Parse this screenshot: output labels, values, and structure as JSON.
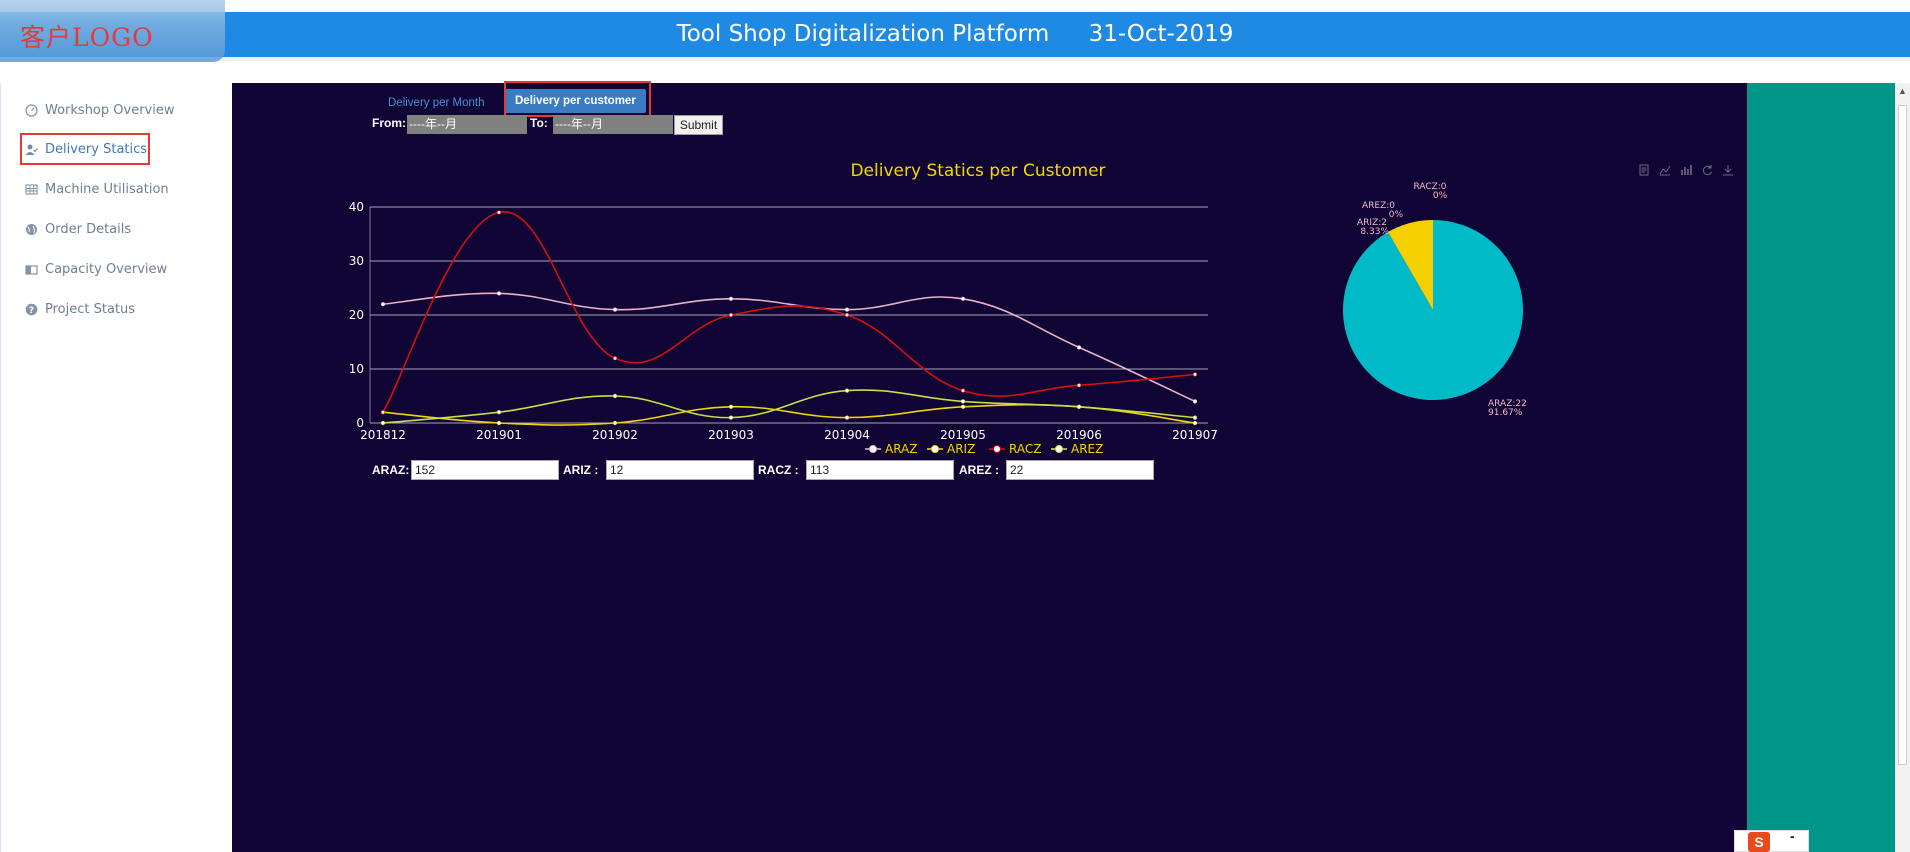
{
  "header": {
    "logo_text": "客户LOGO",
    "title": "Tool Shop Digitalization Platform",
    "date": "31-Oct-2019"
  },
  "sidebar": {
    "items": [
      {
        "label": "Workshop Overview",
        "icon": "dashboard-icon"
      },
      {
        "label": "Delivery Statics",
        "icon": "user-check-icon",
        "active": true
      },
      {
        "label": "Machine Utilisation",
        "icon": "table-icon"
      },
      {
        "label": "Order Details",
        "icon": "globe-icon"
      },
      {
        "label": "Capacity Overview",
        "icon": "folder-icon"
      },
      {
        "label": "Project Status",
        "icon": "help-circle-icon"
      }
    ]
  },
  "tabs": {
    "month": "Delivery per Month",
    "customer": "Delivery per customer"
  },
  "filter": {
    "from_label": "From:",
    "from_value": "----年--月",
    "to_label": "To:",
    "to_value": "----年--月",
    "submit_label": "Submit"
  },
  "totals": [
    {
      "label": "ARAZ:",
      "value": "152"
    },
    {
      "label": "ARIZ :",
      "value": "12"
    },
    {
      "label": "RACZ :",
      "value": "113"
    },
    {
      "label": "AREZ :",
      "value": "22"
    }
  ],
  "colors": {
    "header": "#1f8ae3",
    "panel": "#100535",
    "teal": "#009688",
    "highlight": "#e53935",
    "title": "#f5d700"
  },
  "chart_data": [
    {
      "type": "line",
      "title": "Delivery Statics per Customer",
      "categories": [
        "201812",
        "201901",
        "201902",
        "201903",
        "201904",
        "201905",
        "201906",
        "201907"
      ],
      "ylim": [
        0,
        40
      ],
      "yticks": [
        0,
        10,
        20,
        30,
        40
      ],
      "grid": true,
      "legend": "bottom",
      "series": [
        {
          "name": "ARAZ",
          "color": "#e8b4c8",
          "values": [
            22,
            24,
            21,
            23,
            21,
            23,
            14,
            4
          ]
        },
        {
          "name": "ARIZ",
          "color": "#f2d40a",
          "values": [
            2,
            0,
            0,
            3,
            1,
            3,
            3,
            0
          ]
        },
        {
          "name": "RACZ",
          "color": "#d50f0f",
          "values": [
            2,
            39,
            12,
            20,
            20,
            6,
            7,
            9
          ]
        },
        {
          "name": "AREZ",
          "color": "#c4e04a",
          "values": [
            0,
            2,
            5,
            1,
            6,
            4,
            3,
            1
          ]
        }
      ]
    },
    {
      "type": "pie",
      "slices": [
        {
          "name": "ARAZ",
          "value": 22,
          "percent": "91.67%",
          "color": "#00bac8"
        },
        {
          "name": "ARIZ",
          "value": 2,
          "percent": "8.33%",
          "color": "#f5d000"
        },
        {
          "name": "AREZ",
          "value": 0,
          "percent": "0%",
          "color": "#c4e04a"
        },
        {
          "name": "RACZ",
          "value": 0,
          "percent": "0%",
          "color": "#d50f0f"
        }
      ]
    }
  ]
}
